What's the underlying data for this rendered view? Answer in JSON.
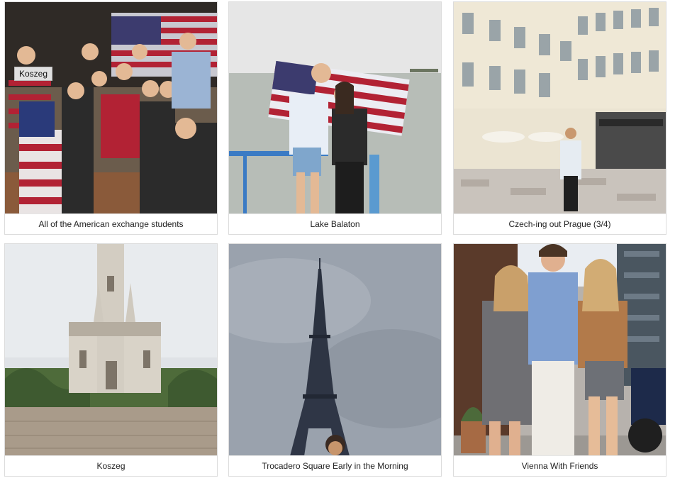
{
  "gallery": {
    "items": [
      {
        "caption": "All of the American exchange students",
        "tooltip": "Koszeg"
      },
      {
        "caption": "Lake Balaton"
      },
      {
        "caption": "Czech-ing out Prague (3/4)"
      },
      {
        "caption": "Koszeg"
      },
      {
        "caption": "Trocadero Square Early in the Morning"
      },
      {
        "caption": "Vienna With Friends"
      }
    ]
  }
}
